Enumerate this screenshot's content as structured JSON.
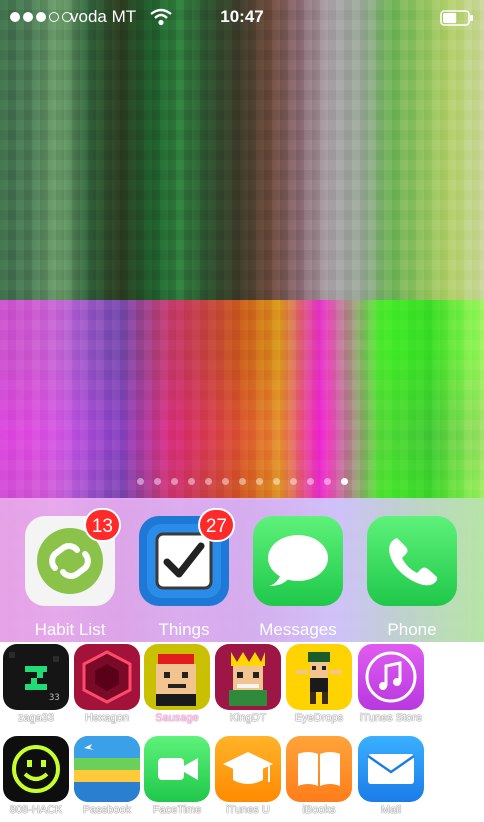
{
  "status_bar": {
    "signal_filled": 3,
    "signal_total": 5,
    "carrier": "voda MT",
    "time": "10:47",
    "battery_level_percent": 55
  },
  "page_indicator": {
    "count": 13,
    "active_index": 12
  },
  "dock": {
    "apps": [
      {
        "label": "Habit List",
        "badge": "13",
        "icon": "habit-list-icon",
        "color": "#8bc34a"
      },
      {
        "label": "Things",
        "badge": "27",
        "icon": "things-checkbox-icon",
        "color": "#1e78d6"
      },
      {
        "label": "Messages",
        "badge": "",
        "icon": "messages-bubble-icon",
        "color": "#35d05a"
      },
      {
        "label": "Phone",
        "badge": "",
        "icon": "phone-handset-icon",
        "color": "#35d05a"
      }
    ]
  },
  "grid": {
    "row1": [
      {
        "label": "zaga33",
        "icon": "zaga33-icon"
      },
      {
        "label": "Hexagon",
        "icon": "hexagon-game-icon"
      },
      {
        "label": "Sausage",
        "icon": "sausage-legend-icon"
      },
      {
        "label": "KingDT",
        "icon": "king-dt-icon"
      },
      {
        "label": "EyeDrops",
        "icon": "eyedrops-game-icon"
      },
      {
        "label": "iTunes Store",
        "icon": "itunes-store-icon"
      }
    ],
    "row2": [
      {
        "label": "808-HACK",
        "icon": "smiley-hack-icon"
      },
      {
        "label": "Passbook",
        "icon": "passbook-icon"
      },
      {
        "label": "FaceTime",
        "icon": "facetime-camera-icon"
      },
      {
        "label": "iTunes U",
        "icon": "itunes-u-mortarboard-icon"
      },
      {
        "label": "iBooks",
        "icon": "ibooks-icon"
      },
      {
        "label": "Mail",
        "icon": "mail-envelope-icon"
      }
    ]
  }
}
